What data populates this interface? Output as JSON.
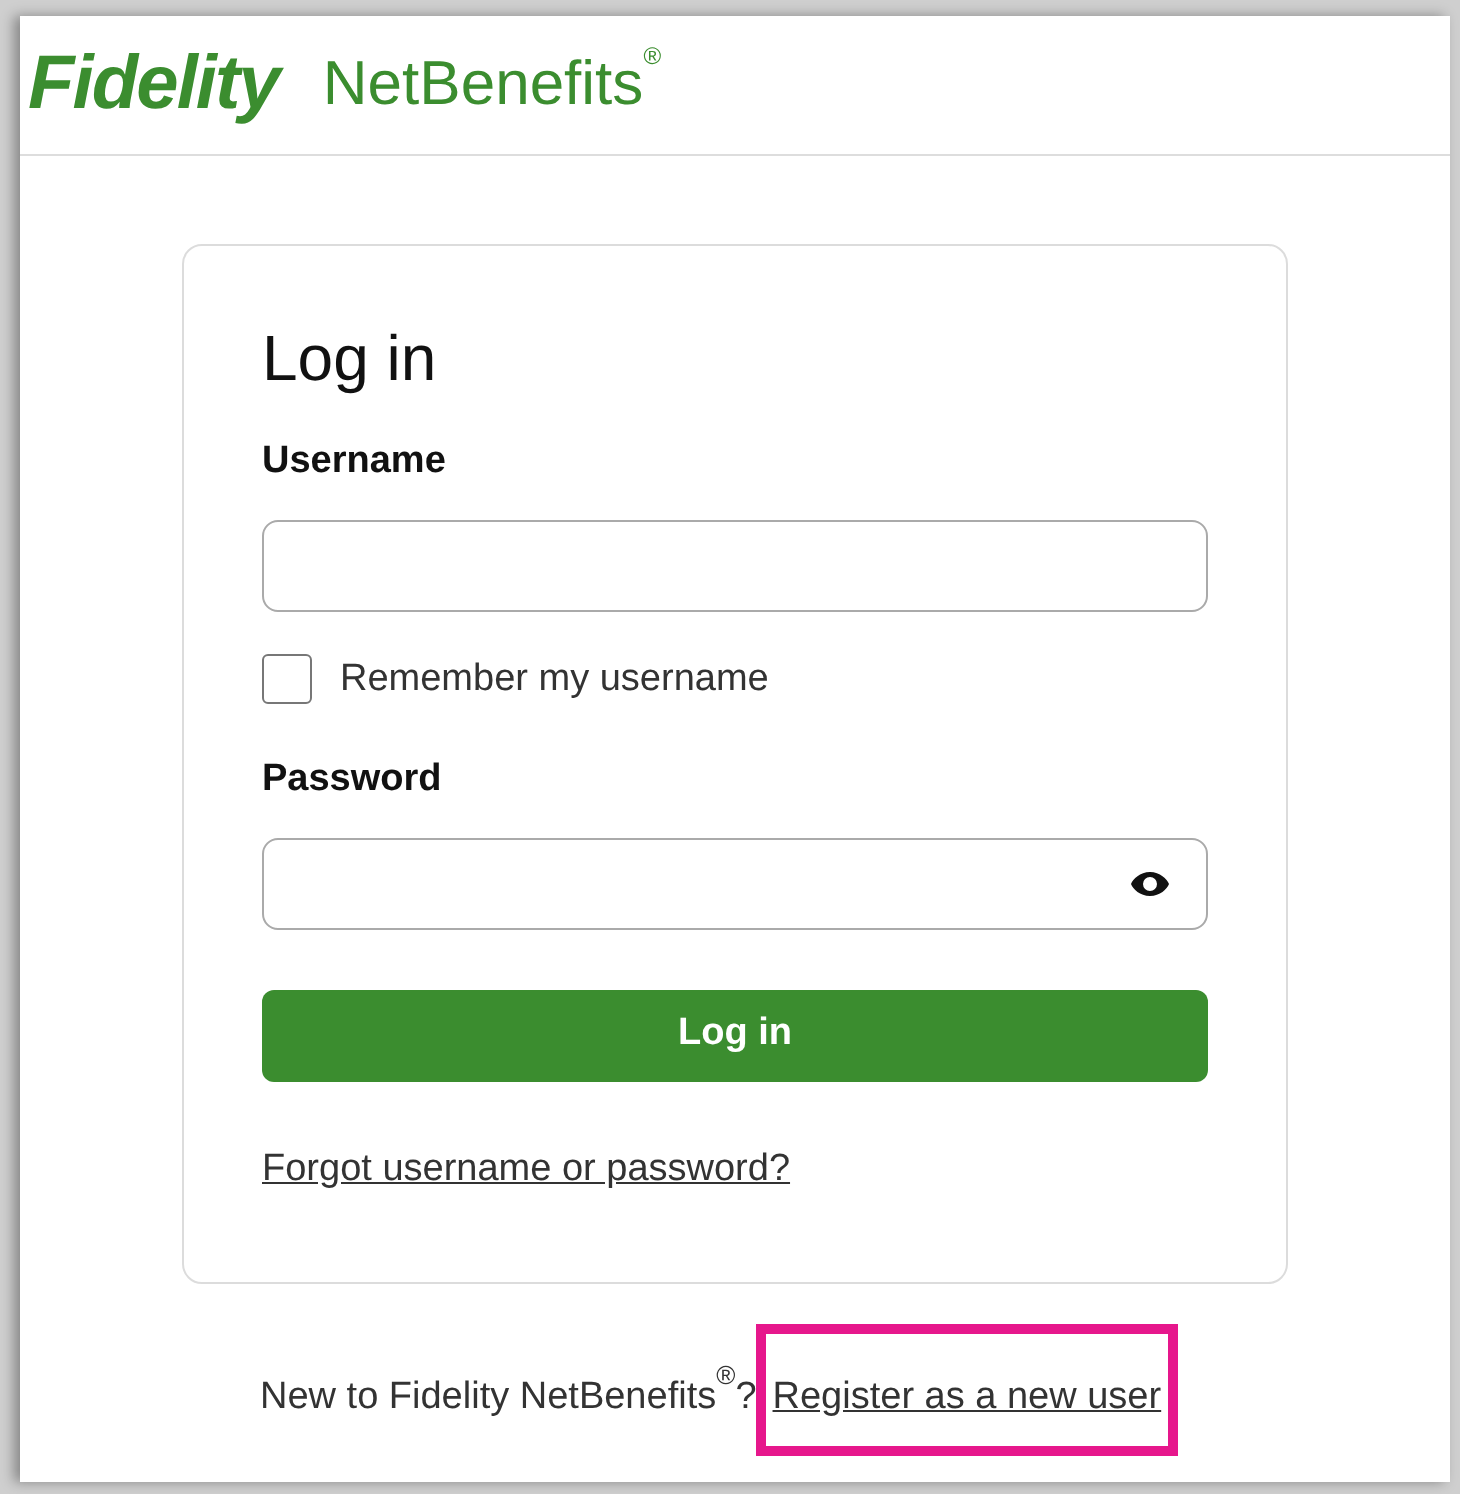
{
  "header": {
    "brand": "Fidelity",
    "product": "NetBenefits$^{®}$"
  },
  "login": {
    "title": "Log in",
    "fields": [
      {
        "label": "Username",
        "kind": "text"
      },
      {
        "kind": "checkbox",
        "label": "Remember my username",
        "checked": false
      },
      {
        "label": "Password",
        "kind": "password"
      }
    ],
    "button": "Log in",
    "forgot_link": "Forgot username or password?"
  },
  "footer": {
    "prompt": "New to Fidelity NetBenefits$^{®}$?",
    "link": "Register as a new user",
    "highlighted": true
  }
}
